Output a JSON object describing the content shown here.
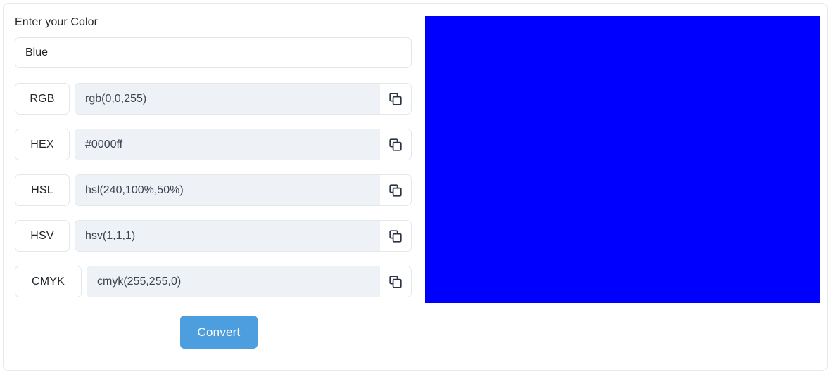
{
  "form": {
    "heading": "Enter your Color",
    "color_input": {
      "value": "Blue",
      "placeholder": "Enter your Color"
    },
    "rows": [
      {
        "label": "RGB",
        "value": "rgb(0,0,255)",
        "copy_icon": "copy-icon",
        "copy_title": "Copy"
      },
      {
        "label": "HEX",
        "value": "#0000ff",
        "copy_icon": "copy-icon",
        "copy_title": "Copy"
      },
      {
        "label": "HSL",
        "value": "hsl(240,100%,50%)",
        "copy_icon": "copy-icon",
        "copy_title": "Copy"
      },
      {
        "label": "HSV",
        "value": "hsv(1,1,1)",
        "copy_icon": "copy-icon",
        "copy_title": "Copy"
      },
      {
        "label": "CMYK",
        "value": "cmyk(255,255,0)",
        "copy_icon": "copy-icon",
        "copy_title": "Copy"
      }
    ],
    "convert_button": "Convert"
  },
  "preview": {
    "color": "#0000ff"
  },
  "colors": {
    "accent": "#4d9ede",
    "preview": "#0000ff",
    "readonly_bg": "#eef1f6",
    "border": "#e4e7ea",
    "text": "#212529"
  }
}
